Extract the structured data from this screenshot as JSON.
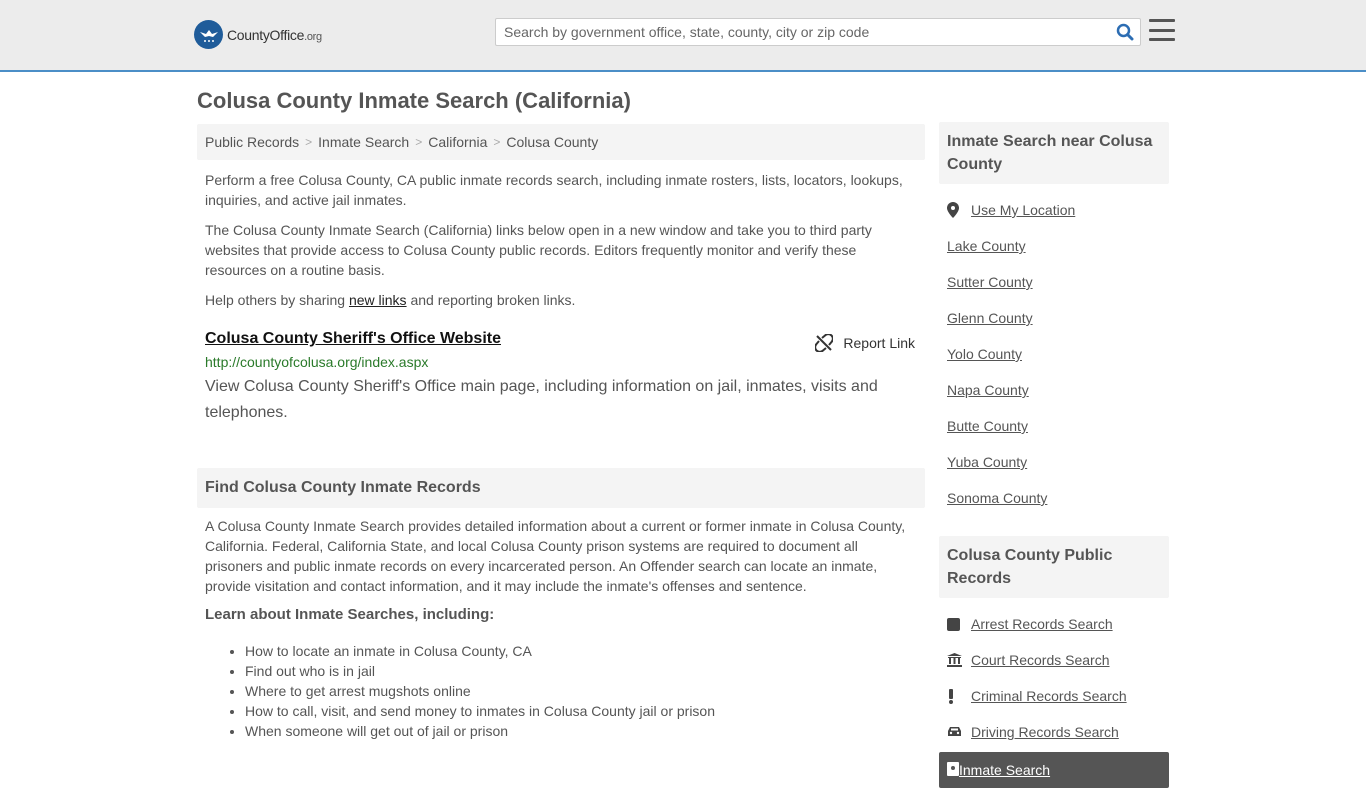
{
  "header": {
    "logo_main": "CountyOffice",
    "logo_suffix": ".org",
    "search_placeholder": "Search by government office, state, county, city or zip code",
    "search_value": ""
  },
  "page_title": "Colusa County Inmate Search (California)",
  "breadcrumb": [
    "Public Records",
    "Inmate Search",
    "California",
    "Colusa County"
  ],
  "intro": {
    "p1": "Perform a free Colusa County, CA public inmate records search, including inmate rosters, lists, locators, lookups, inquiries, and active jail inmates.",
    "p2": "The Colusa County Inmate Search (California) links below open in a new window and take you to third party websites that provide access to Colusa County public records. Editors frequently monitor and verify these resources on a routine basis.",
    "p3_before": "Help others by sharing ",
    "p3_link": "new links",
    "p3_after": " and reporting broken links."
  },
  "link_card": {
    "title": "Colusa County Sheriff's Office Website",
    "report_label": "Report Link",
    "url": "http://countyofcolusa.org/index.aspx",
    "description": "View Colusa County Sheriff's Office main page, including information on jail, inmates, visits and telephones."
  },
  "records_section": {
    "heading": "Find Colusa County Inmate Records",
    "paragraph": "A Colusa County Inmate Search provides detailed information about a current or former inmate in Colusa County, California. Federal, California State, and local Colusa County prison systems are required to document all prisoners and public inmate records on every incarcerated person. An Offender search can locate an inmate, provide visitation and contact information, and it may include the inmate's offenses and sentence.",
    "learn_heading": "Learn about Inmate Searches, including:",
    "bullets": [
      "How to locate an inmate in Colusa County, CA",
      "Find out who is in jail",
      "Where to get arrest mugshots online",
      "How to call, visit, and send money to inmates in Colusa County jail or prison",
      "When someone will get out of jail or prison"
    ]
  },
  "sidebar": {
    "nearby_heading": "Inmate Search near Colusa County",
    "use_location": "Use My Location",
    "nearby": [
      "Lake County",
      "Sutter County",
      "Glenn County",
      "Yolo County",
      "Napa County",
      "Butte County",
      "Yuba County",
      "Sonoma County"
    ],
    "records_heading": "Colusa County Public Records",
    "records": [
      {
        "label": "Arrest Records Search",
        "icon": "square-icon"
      },
      {
        "label": "Court Records Search",
        "icon": "courthouse-icon"
      },
      {
        "label": "Criminal Records Search",
        "icon": "exclamation-icon"
      },
      {
        "label": "Driving Records Search",
        "icon": "car-icon"
      }
    ],
    "active_record": "Inmate Search"
  }
}
